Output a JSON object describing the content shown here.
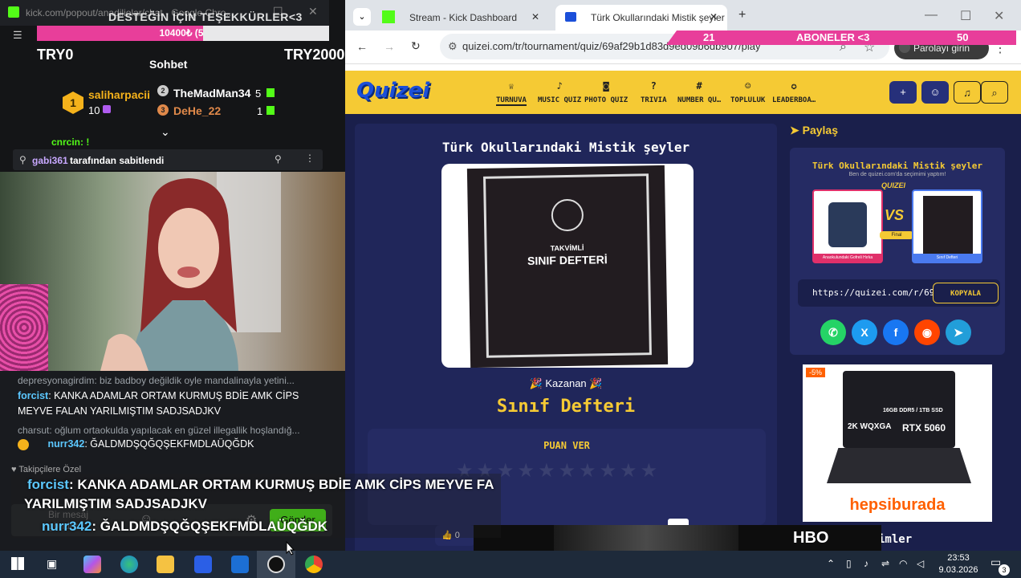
{
  "kick_popout": {
    "url": "kick.com/popout/anadiliolar/chat - Google Chro...",
    "donation_overlay_text": "DESTEĞİN İÇİN TEŞEKKÜRLER<3",
    "donation_bar_text": "10400₺ (5",
    "donation_progress_percent": 57,
    "try_left": "TRY0",
    "try_right": "TRY20000",
    "chat_heading": "Sohbet",
    "leaderboard": [
      {
        "rank": "1",
        "name": "saliharpacii",
        "count": "10"
      },
      {
        "rank": "2",
        "name": "TheMadMan34",
        "count": "5"
      },
      {
        "rank": "3",
        "name": "DeHe_22",
        "count": "1"
      }
    ],
    "partial_user": "cnrcin: !",
    "pinned": {
      "user": "gabi361",
      "text": "tarafından sabitlendi"
    },
    "chat_messages": [
      {
        "reply": "depresyonagirdim: biz badboy değildik oyle mandalinayla yetini...",
        "user": "forcist",
        "text": ": KANKA ADAMLAR ORTAM KURMUŞ BDİE AMK CİPS MEYVE FALAN YARILMIŞTIM SADJSADJKV"
      },
      {
        "reply": "charsut: oğlum ortaokulda yapılacak en güzel illegallik hoşlandığ...",
        "user": "nurr342",
        "text": ": ĞALDMDŞQĞQŞEKFMDLAÜQĞDK"
      }
    ],
    "followers_only": "Takipçilere Özel",
    "overlay": {
      "line1_user": "forcist",
      "line1_text": ": KANKA ADAMLAR ORTAM KURMUŞ BDİE AMK CİPS MEYVE FA",
      "line2_text": "YARILMIŞTIM SADJSADJKV",
      "line3_user": "nurr342",
      "line3_text": ": ĞALDMDŞQĞQŞEKFMDLAÜQĞDK"
    },
    "input_placeholder": "Bir mesaj gönder",
    "send_label": "Gönder"
  },
  "browser": {
    "tabs": [
      {
        "label": "Stream - Kick Dashboard"
      },
      {
        "label": "Türk Okullarındaki Mistik şeyler"
      }
    ],
    "url": "quizei.com/tr/tournament/quiz/69af29b1d83d9ed09b6db907/play",
    "password_label": "Parolayı girin",
    "subs_overlay": {
      "left": "21",
      "label": "ABONELER <3",
      "right": "50"
    }
  },
  "site": {
    "logo": "Quizei",
    "nav": [
      {
        "icon": "trophy-icon",
        "glyph": "♕",
        "label": "TURNUVA"
      },
      {
        "icon": "music-icon",
        "glyph": "♪",
        "label": "MUSIC QUIZ"
      },
      {
        "icon": "camera-icon",
        "glyph": "◙",
        "label": "PHOTO QUIZ"
      },
      {
        "icon": "question-icon",
        "glyph": "?",
        "label": "TRIVIA"
      },
      {
        "icon": "hash-icon",
        "glyph": "#",
        "label": "NUMBER QU…"
      },
      {
        "icon": "people-icon",
        "glyph": "☺",
        "label": "TOPLULUK"
      },
      {
        "icon": "medal-icon",
        "glyph": "✪",
        "label": "LEADERBOA…"
      }
    ],
    "quiz_title": "Türk Okullarındaki Mistik şeyler",
    "image_caption_small": "TAKVİMLİ",
    "image_caption": "SINIF DEFTERİ",
    "winner_label": "Kazanan",
    "winner_name": "Sınıf Defteri",
    "rate_title": "PUAN VER",
    "stars": "★★★★★★★★★★",
    "likes": "0",
    "share": {
      "heading": "Paylaş",
      "card_title": "Türk Okullarındaki Mistik şeyler",
      "card_sub": "Ben de quizei.com'da seçimimi yaptım!",
      "card_brand": "QUIZEI",
      "left_item": "Anaokulundaki Gofreli Hırka",
      "vs": "VS",
      "final": "Final",
      "right_item": "Sınıf Defteri",
      "link": "https://quizei.com/r/69",
      "copy_label": "KOPYALA"
    },
    "ad": {
      "discount": "-5%",
      "ram": "16GB DDR5 / 1TB SSD",
      "screen": "2K WQXGA",
      "gpu": "RTX 5060",
      "brand": "hepsiburada"
    },
    "bottom_partial": "imler"
  },
  "taskbar": {
    "time": "23:53",
    "date": "9.03.2026",
    "notification_count": "3"
  },
  "colors": {
    "kick_green": "#53fc18",
    "quizei_yellow": "#f5ca34",
    "quizei_navy": "#1a1f4b",
    "pink": "#e83e9a"
  }
}
